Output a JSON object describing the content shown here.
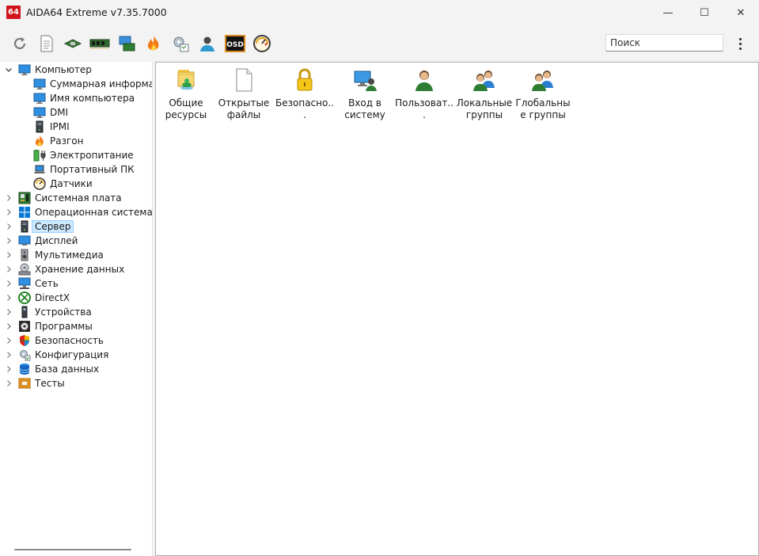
{
  "window": {
    "logo_text": "64",
    "title": "AIDA64 Extreme v7.35.7000",
    "minimize_glyph": "—",
    "maximize_glyph": "☐",
    "close_glyph": "✕"
  },
  "toolbar": {
    "buttons": [
      {
        "name": "refresh-icon"
      },
      {
        "name": "report-icon"
      },
      {
        "name": "motherboard-icon"
      },
      {
        "name": "memory-icon"
      },
      {
        "name": "network-icon"
      },
      {
        "name": "flame-icon"
      },
      {
        "name": "settings-icon"
      },
      {
        "name": "user-icon"
      },
      {
        "name": "osd-icon",
        "text": "OSD"
      },
      {
        "name": "gauge-icon"
      }
    ],
    "search_placeholder": "Поиск"
  },
  "tree": {
    "items": [
      {
        "label": "Компьютер",
        "level": 0,
        "expanded": true,
        "icon": "monitor-icon"
      },
      {
        "label": "Суммарная информация",
        "level": 1,
        "icon": "monitor-icon"
      },
      {
        "label": "Имя компьютера",
        "level": 1,
        "icon": "monitor-icon"
      },
      {
        "label": "DMI",
        "level": 1,
        "icon": "monitor-icon"
      },
      {
        "label": "IPMI",
        "level": 1,
        "icon": "server-icon"
      },
      {
        "label": "Разгон",
        "level": 1,
        "icon": "flame-icon"
      },
      {
        "label": "Электропитание",
        "level": 1,
        "icon": "battery-icon"
      },
      {
        "label": "Портативный ПК",
        "level": 1,
        "icon": "laptop-icon"
      },
      {
        "label": "Датчики",
        "level": 1,
        "icon": "gauge-icon"
      },
      {
        "label": "Системная плата",
        "level": 0,
        "icon": "motherboard-icon"
      },
      {
        "label": "Операционная система",
        "level": 0,
        "icon": "windows-icon"
      },
      {
        "label": "Сервер",
        "level": 0,
        "selected": true,
        "icon": "server-icon"
      },
      {
        "label": "Дисплей",
        "level": 0,
        "icon": "display-icon"
      },
      {
        "label": "Мультимедиа",
        "level": 0,
        "icon": "speaker-icon"
      },
      {
        "label": "Хранение данных",
        "level": 0,
        "icon": "storage-icon"
      },
      {
        "label": "Сеть",
        "level": 0,
        "icon": "network-icon"
      },
      {
        "label": "DirectX",
        "level": 0,
        "icon": "xbox-icon"
      },
      {
        "label": "Устройства",
        "level": 0,
        "icon": "device-icon"
      },
      {
        "label": "Программы",
        "level": 0,
        "icon": "programs-icon"
      },
      {
        "label": "Безопасность",
        "level": 0,
        "icon": "shield-icon"
      },
      {
        "label": "Конфигурация",
        "level": 0,
        "icon": "config-icon"
      },
      {
        "label": "База данных",
        "level": 0,
        "icon": "database-icon"
      },
      {
        "label": "Тесты",
        "level": 0,
        "icon": "tests-icon"
      }
    ]
  },
  "content": {
    "items": [
      {
        "label": "Общие ресурсы",
        "icon": "shared-folder-icon"
      },
      {
        "label": "Открытые файлы",
        "icon": "file-icon"
      },
      {
        "label": "Безопасно...",
        "icon": "lock-icon"
      },
      {
        "label": "Вход в систему",
        "icon": "login-icon"
      },
      {
        "label": "Пользоват...",
        "icon": "user-icon"
      },
      {
        "label": "Локальные группы",
        "icon": "users-icon"
      },
      {
        "label": "Глобальные группы",
        "icon": "users-icon"
      }
    ]
  },
  "colors": {
    "accent_red": "#d0121b",
    "selection_bg": "#cce8ff",
    "selection_border": "#99d1ff"
  }
}
